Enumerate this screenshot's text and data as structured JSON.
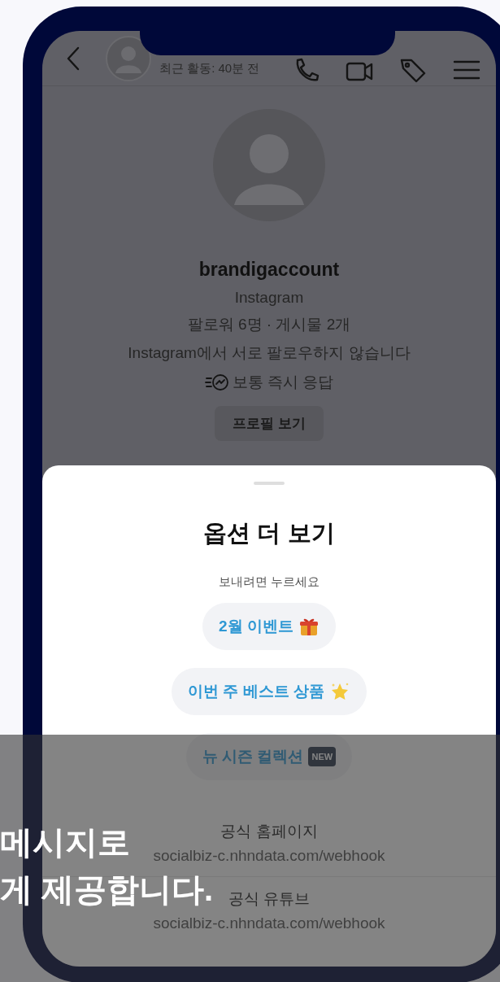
{
  "header": {
    "status": "최근 활동: 40분 전"
  },
  "profile": {
    "username": "brandigaccount",
    "platform": "Instagram",
    "stats": "팔로워 6명 · 게시물 2개",
    "follow_note": "Instagram에서 서로 팔로우하지 않습니다",
    "response": "보통 즉시 응답",
    "button": "프로필 보기"
  },
  "sheet": {
    "title": "옵션 더 보기",
    "subtitle": "보내려면 누르세요",
    "quick_replies": [
      {
        "label": "2월 이벤트",
        "kind": "gift"
      },
      {
        "label": "이번 주 베스트 상품",
        "kind": "star"
      },
      {
        "label": "뉴 시즌 컬렉션",
        "kind": "badge",
        "badge": "NEW"
      }
    ],
    "links": [
      {
        "title": "공식 홈페이지",
        "url": "socialbiz-c.nhndata.com/webhook"
      },
      {
        "title": "공식 유튜브",
        "url": "socialbiz-c.nhndata.com/webhook"
      }
    ]
  },
  "caption": [
    "메시지로",
    "게 제공합니다."
  ]
}
